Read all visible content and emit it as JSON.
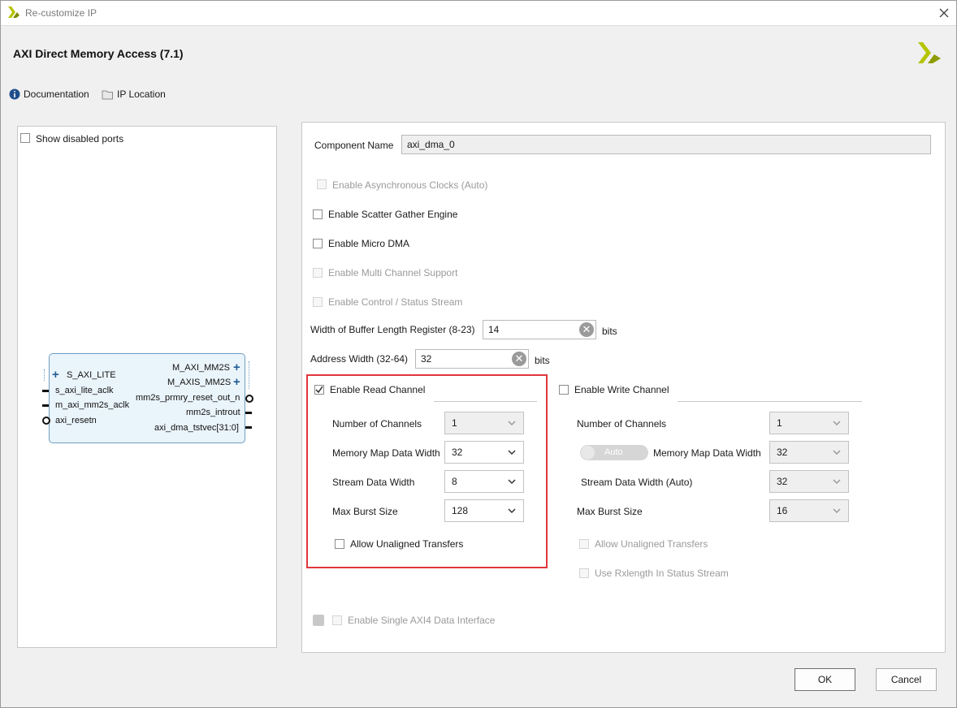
{
  "window": {
    "title": "Re-customize IP"
  },
  "header": {
    "ip_name": "AXI Direct Memory Access (7.1)",
    "links": [
      {
        "label": "Documentation",
        "icon": "info-icon"
      },
      {
        "label": "IP Location",
        "icon": "folder-icon"
      }
    ]
  },
  "left_panel": {
    "show_disabled_ports_label": "Show disabled ports",
    "block": {
      "left_ports": [
        "S_AXI_LITE",
        "s_axi_lite_aclk",
        "m_axi_mm2s_aclk",
        "axi_resetn"
      ],
      "right_ports": [
        "M_AXI_MM2S",
        "M_AXIS_MM2S",
        "mm2s_prmry_reset_out_n",
        "mm2s_introut",
        "axi_dma_tstvec[31:0]"
      ]
    }
  },
  "config": {
    "component_name_label": "Component Name",
    "component_name_value": "axi_dma_0",
    "options": {
      "async_clocks": "Enable Asynchronous Clocks (Auto)",
      "scatter_gather": "Enable Scatter Gather Engine",
      "micro_dma": "Enable Micro DMA",
      "multi_channel": "Enable Multi Channel Support",
      "control_status": "Enable Control / Status Stream"
    },
    "buffer_length": {
      "label": "Width of Buffer Length Register (8-23)",
      "value": "14",
      "unit": "bits"
    },
    "address_width": {
      "label": "Address Width (32-64)",
      "value": "32",
      "unit": "bits"
    },
    "read_channel": {
      "title": "Enable Read Channel",
      "checked": true,
      "fields": [
        {
          "label": "Number of Channels",
          "value": "1"
        },
        {
          "label": "Memory Map Data Width",
          "value": "32"
        },
        {
          "label": "Stream Data Width",
          "value": "8"
        },
        {
          "label": "Max Burst Size",
          "value": "128"
        }
      ],
      "unaligned": "Allow Unaligned Transfers"
    },
    "write_channel": {
      "title": "Enable Write Channel",
      "checked": false,
      "auto_toggle": "Auto",
      "fields": [
        {
          "label": "Number of Channels",
          "value": "1"
        },
        {
          "label": "Memory Map Data Width",
          "value": "32"
        },
        {
          "label": "Stream Data Width (Auto)",
          "value": "32"
        },
        {
          "label": "Max Burst Size",
          "value": "16"
        }
      ],
      "unaligned": "Allow Unaligned Transfers",
      "rxlength": "Use Rxlength In Status Stream"
    },
    "single_axi4": "Enable Single AXI4 Data Interface"
  },
  "footer": {
    "ok": "OK",
    "cancel": "Cancel"
  },
  "colors": {
    "highlight_box": "#e0363b",
    "xilinx_logo": "#b5c400"
  }
}
